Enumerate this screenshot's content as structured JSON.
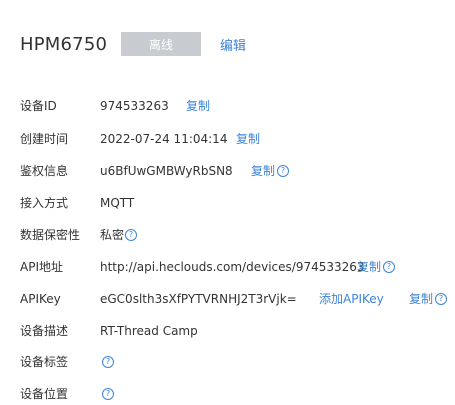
{
  "header": {
    "title": "HPM6750",
    "status": "离线",
    "edit_label": "编辑"
  },
  "fields": {
    "device_id": {
      "label": "设备ID",
      "value": "974533263",
      "action": "复制"
    },
    "created": {
      "label": "创建时间",
      "value": "2022-07-24 11:04:14",
      "action": "复制"
    },
    "auth": {
      "label": "鉴权信息",
      "value": "u6BfUwGMBWyRbSN8",
      "action": "复制"
    },
    "access": {
      "label": "接入方式",
      "value": "MQTT"
    },
    "privacy": {
      "label": "数据保密性",
      "value": "私密"
    },
    "api": {
      "label": "API地址",
      "value": "http://api.heclouds.com/devices/974533263",
      "action": "复制"
    },
    "apikey": {
      "label": "APIKey",
      "value": "eGC0slth3sXfPYTVRNHJ2T3rVjk=",
      "add": "添加APIKey",
      "action": "复制"
    },
    "desc": {
      "label": "设备描述",
      "value": "RT-Thread Camp"
    },
    "tags": {
      "label": "设备标签"
    },
    "location": {
      "label": "设备位置"
    }
  },
  "icons": {
    "help": "question-circle-icon"
  },
  "colors": {
    "link": "#3d84d8",
    "badge_bg": "#c8cbd0",
    "text": "#333333"
  }
}
